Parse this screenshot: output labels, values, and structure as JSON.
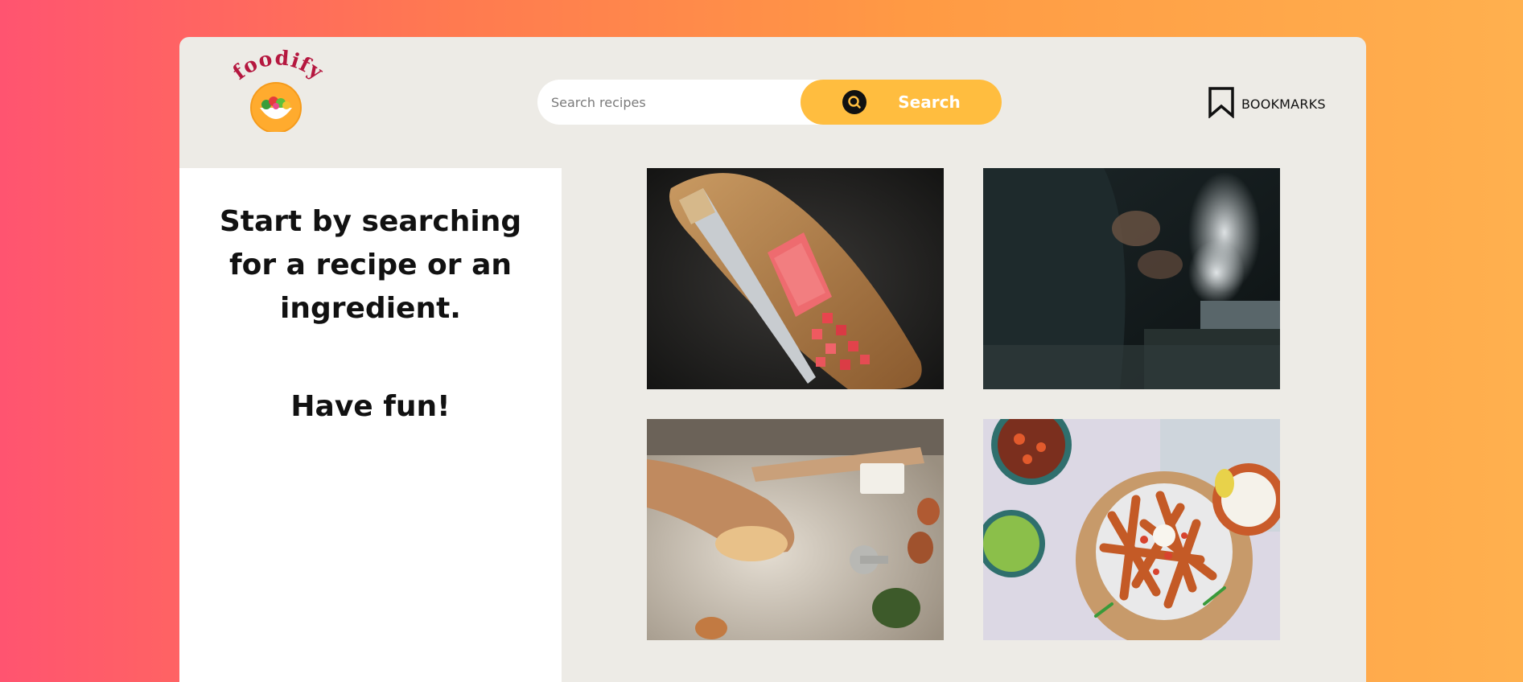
{
  "app": {
    "logo_text": "foodify"
  },
  "search": {
    "placeholder": "Search recipes",
    "button_label": "Search"
  },
  "header": {
    "bookmarks_label": "BOOKMARKS"
  },
  "sidebar": {
    "message": "Start by searching for a recipe or an ingredient.",
    "fun_message": "Have fun!"
  },
  "gallery": {
    "images": [
      {
        "subject": "knife and tuna on wooden cutting board"
      },
      {
        "subject": "chef cooking with steam in dark kitchen"
      },
      {
        "subject": "hands kneading dough on floured table"
      },
      {
        "subject": "sweet potato fries with salad bowls"
      }
    ]
  },
  "colors": {
    "accent": "#ffbd3f",
    "logo_text": "#b5173f",
    "panel": "#edebe6"
  }
}
